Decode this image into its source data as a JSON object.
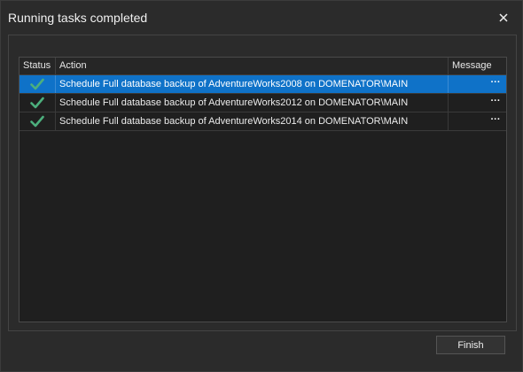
{
  "window": {
    "title": "Running tasks completed",
    "close_label": "✕"
  },
  "grid": {
    "columns": {
      "status": "Status",
      "action": "Action",
      "message": "Message"
    },
    "rows": [
      {
        "status": "completed",
        "action": "Schedule Full database backup of AdventureWorks2008 on DOMENATOR\\MAIN",
        "message_button": "···",
        "selected": true
      },
      {
        "status": "completed",
        "action": "Schedule Full database backup of AdventureWorks2012 on DOMENATOR\\MAIN",
        "message_button": "···",
        "selected": false
      },
      {
        "status": "completed",
        "action": "Schedule Full database backup of AdventureWorks2014 on DOMENATOR\\MAIN",
        "message_button": "···",
        "selected": false
      }
    ]
  },
  "footer": {
    "finish_label": "Finish"
  },
  "colors": {
    "selection": "#0f72c8",
    "check": "#4caf7d"
  },
  "icons": {
    "status": "checkmark-icon",
    "close": "close-icon"
  }
}
